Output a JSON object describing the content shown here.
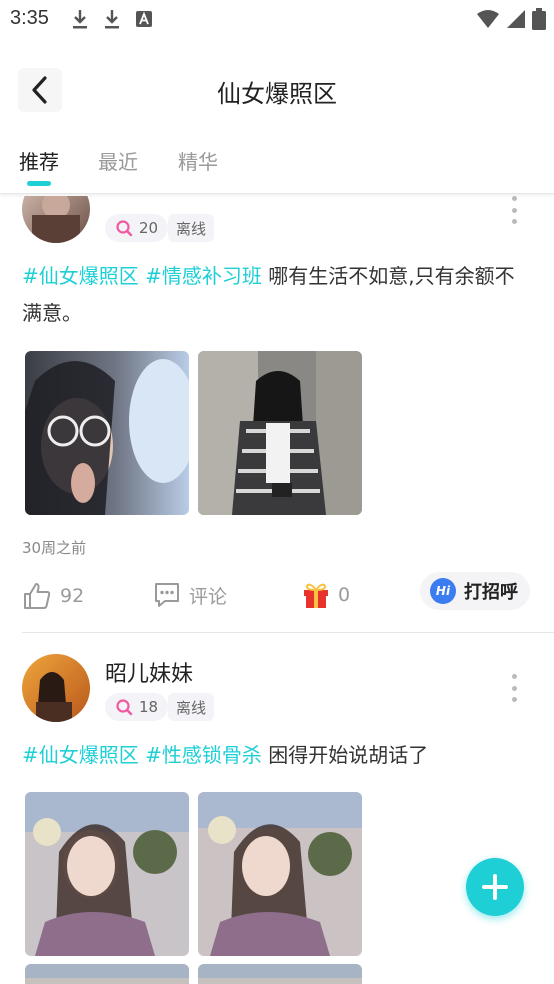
{
  "status_bar": {
    "time": "3:35"
  },
  "header": {
    "title": "仙女爆照区"
  },
  "tabs": [
    {
      "label": "推荐",
      "active": true
    },
    {
      "label": "最近",
      "active": false
    },
    {
      "label": "精华",
      "active": false
    }
  ],
  "posts": [
    {
      "username": "",
      "charm": "20",
      "status": "离线",
      "tags": [
        "#仙女爆照区",
        "#情感补习班"
      ],
      "text": "哪有生活不如意,只有余额不满意。",
      "time": "30周之前",
      "likes": "92",
      "comment_label": "评论",
      "gifts": "0",
      "greet_label": "打招呼",
      "greet_icon_text": "Hi"
    },
    {
      "username": "昭儿妹妹",
      "charm": "18",
      "status": "离线",
      "tags": [
        "#仙女爆照区",
        "#性感锁骨杀"
      ],
      "text": "困得开始说胡话了"
    }
  ],
  "colors": {
    "accent": "#1ecfd6",
    "tag": "#1ecfd6",
    "greet_icon": "#3b7cf0",
    "gift": "#e8322c"
  }
}
